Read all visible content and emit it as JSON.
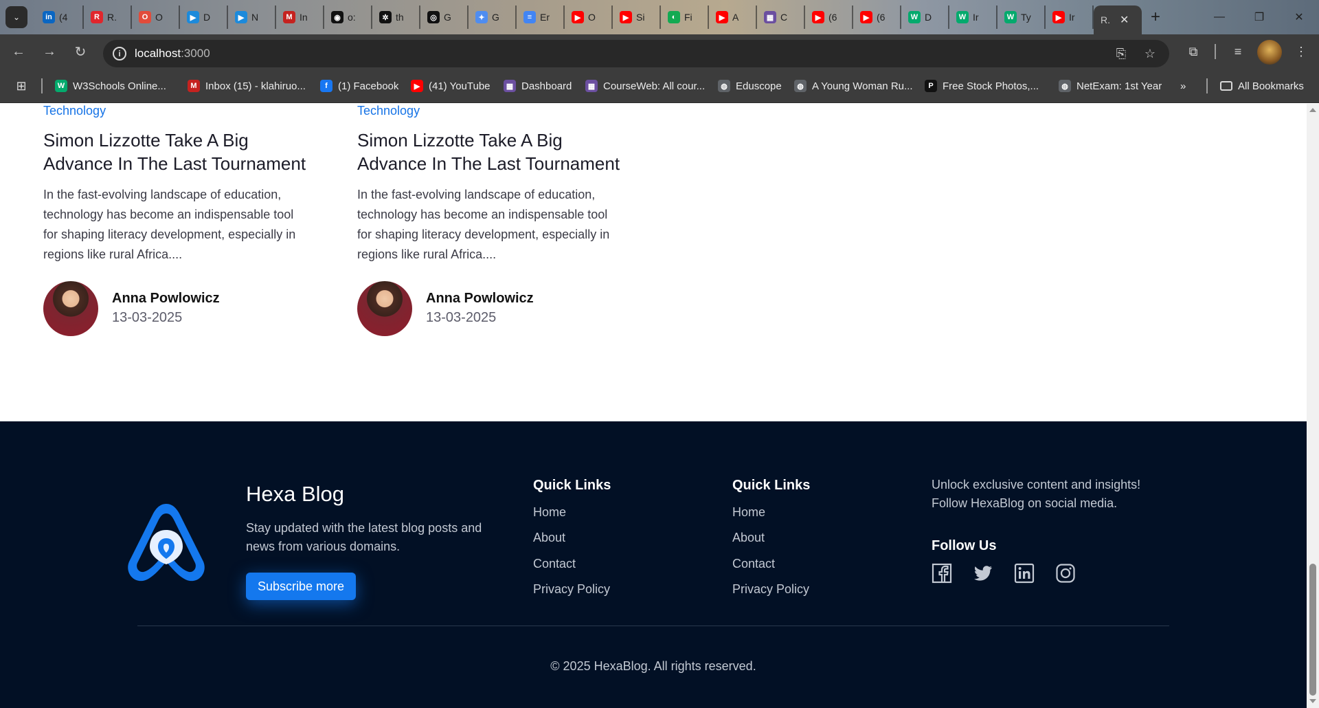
{
  "browser": {
    "tabs": [
      {
        "label": "(4",
        "fav": "in",
        "color": "#0a66c2"
      },
      {
        "label": "R.",
        "fav": "R",
        "color": "#e1262c"
      },
      {
        "label": "O",
        "fav": "O",
        "color": "#e24c3b"
      },
      {
        "label": "D",
        "fav": "▶",
        "color": "#1c8adb"
      },
      {
        "label": "N",
        "fav": "▶",
        "color": "#1c8adb"
      },
      {
        "label": "In",
        "fav": "M",
        "color": "#c5221f"
      },
      {
        "label": "o:",
        "fav": "◉",
        "color": "#111111"
      },
      {
        "label": "th",
        "fav": "✲",
        "color": "#111111"
      },
      {
        "label": "G",
        "fav": "◎",
        "color": "#111111"
      },
      {
        "label": "G",
        "fav": "✦",
        "color": "#4f8df0"
      },
      {
        "label": "Er",
        "fav": "≡",
        "color": "#4285f4"
      },
      {
        "label": "O",
        "fav": "▶",
        "color": "#ff0000"
      },
      {
        "label": "Si",
        "fav": "▶",
        "color": "#ff0000"
      },
      {
        "label": "Fi",
        "fav": "◐",
        "color": "#13aa52"
      },
      {
        "label": "A",
        "fav": "▶",
        "color": "#ff0000"
      },
      {
        "label": "C",
        "fav": "▦",
        "color": "#6b4fa0"
      },
      {
        "label": "(6",
        "fav": "▶",
        "color": "#ff0000"
      },
      {
        "label": "(6",
        "fav": "▶",
        "color": "#ff0000"
      },
      {
        "label": "D",
        "fav": "W",
        "color": "#04aa6d"
      },
      {
        "label": "Ir",
        "fav": "W",
        "color": "#04aa6d"
      },
      {
        "label": "Ty",
        "fav": "W",
        "color": "#04aa6d"
      },
      {
        "label": "Ir",
        "fav": "▶",
        "color": "#ff0000"
      }
    ],
    "active_tab": {
      "label": "R."
    },
    "url_host": "localhost",
    "url_port": ":3000",
    "bookmarks": [
      {
        "label": "W3Schools Online...",
        "icon": "W",
        "color": "#04aa6d"
      },
      {
        "label": "Inbox (15) - klahiruo...",
        "icon": "M",
        "color": "#c5221f"
      },
      {
        "label": "(1) Facebook",
        "icon": "f",
        "color": "#1877f2"
      },
      {
        "label": "(41) YouTube",
        "icon": "▶",
        "color": "#ff0000"
      },
      {
        "label": "Dashboard",
        "icon": "▦",
        "color": "#6b4fa0"
      },
      {
        "label": "CourseWeb: All cour...",
        "icon": "▦",
        "color": "#6b4fa0"
      },
      {
        "label": "Eduscope",
        "icon": "◍",
        "color": "#5f6368"
      },
      {
        "label": "A Young Woman Ru...",
        "icon": "◍",
        "color": "#5f6368"
      },
      {
        "label": "Free Stock Photos,...",
        "icon": "P",
        "color": "#111111"
      },
      {
        "label": "NetExam: 1st Year",
        "icon": "◍",
        "color": "#5f6368"
      }
    ],
    "more_bookmarks": "»",
    "all_bookmarks": "All Bookmarks"
  },
  "posts": [
    {
      "category": "Technology",
      "title": "Simon Lizzotte Take A Big Advance In The Last Tournament",
      "excerpt": "In the fast-evolving landscape of education, technology has become an indispensable tool for shaping literacy development, especially in regions like rural Africa....",
      "author": "Anna Powlowicz",
      "date": "13-03-2025"
    },
    {
      "category": "Technology",
      "title": "Simon Lizzotte Take A Big Advance In The Last Tournament",
      "excerpt": "In the fast-evolving landscape of education, technology has become an indispensable tool for shaping literacy development, especially in regions like rural Africa....",
      "author": "Anna Powlowicz",
      "date": "13-03-2025"
    }
  ],
  "footer": {
    "brand": "Hexa Blog",
    "description": "Stay updated with the latest blog posts and news from various domains.",
    "subscribe_label": "Subscribe more",
    "columns": [
      {
        "heading": "Quick Links",
        "links": [
          "Home",
          "About",
          "Contact",
          "Privacy Policy"
        ]
      },
      {
        "heading": "Quick Links",
        "links": [
          "Home",
          "About",
          "Contact",
          "Privacy Policy"
        ]
      }
    ],
    "promo": "Unlock exclusive content and insights! Follow HexaBlog on social media.",
    "follow_heading": "Follow Us",
    "social": [
      "facebook-icon",
      "twitter-icon",
      "linkedin-icon",
      "instagram-icon"
    ],
    "copyright": "© 2025 HexaBlog. All rights reserved."
  },
  "colors": {
    "accent": "#1478ee",
    "category": "#1673e6",
    "footer_bg": "#021025"
  }
}
